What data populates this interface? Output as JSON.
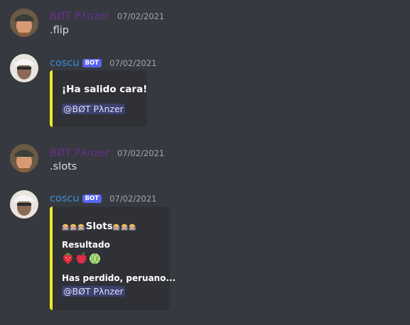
{
  "messages": [
    {
      "author": "BØT Pλnzer",
      "timestamp": "07/02/2021",
      "text": ".flip"
    },
    {
      "author": "coscu",
      "bot_tag": "BOT",
      "timestamp": "07/02/2021",
      "embed": {
        "title": "¡Ha salido cara!",
        "mention": "@BØT Pλnzer"
      }
    },
    {
      "author": "BØT Pλnzer",
      "timestamp": "07/02/2021",
      "text": ".slots"
    },
    {
      "author": "coscu",
      "bot_tag": "BOT",
      "timestamp": "07/02/2021",
      "embed": {
        "title": "Slots",
        "title_icons": "🎰🎰🎰",
        "field_name": "Resultado",
        "emojis": [
          "strawberry",
          "apple",
          "melon"
        ],
        "result": "Has perdido, peruano...",
        "mention": "@BØT Pλnzer"
      }
    }
  ],
  "colors": {
    "embed_accent": "#f1e91d",
    "user_name": "#6a2f8f",
    "bot_name": "#3b8ed6"
  }
}
